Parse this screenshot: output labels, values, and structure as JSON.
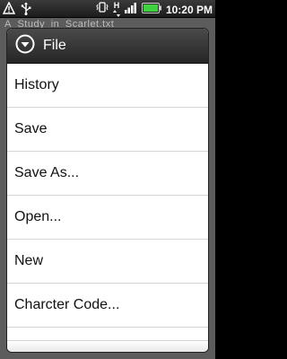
{
  "status_bar": {
    "time": "10:20",
    "ampm": "PM",
    "network_letter": "H",
    "icons": [
      "warning-icon",
      "usb-icon",
      "vibrate-icon",
      "signal-icon",
      "battery-icon"
    ]
  },
  "app": {
    "document_title": "A_Study_in_Scarlet.txt"
  },
  "dialog": {
    "title": "File",
    "items": [
      {
        "label": "History"
      },
      {
        "label": "Save"
      },
      {
        "label": "Save As..."
      },
      {
        "label": "Open..."
      },
      {
        "label": "New"
      },
      {
        "label": "Charcter Code..."
      }
    ]
  },
  "colors": {
    "header_dark": "#262626",
    "battery_green": "#3fd13f"
  }
}
